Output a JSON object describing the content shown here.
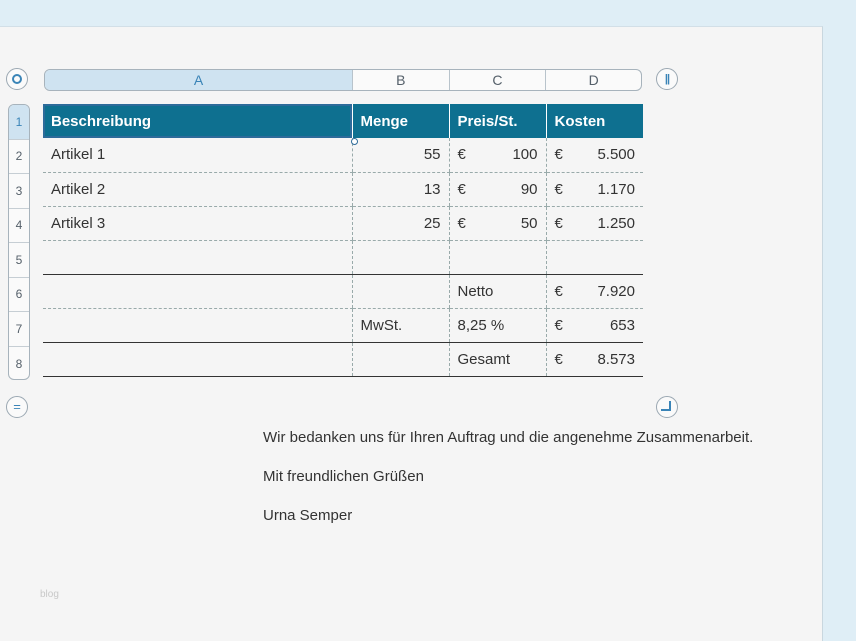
{
  "columns": [
    "A",
    "B",
    "C",
    "D"
  ],
  "rows": [
    "1",
    "2",
    "3",
    "4",
    "5",
    "6",
    "7",
    "8"
  ],
  "header": {
    "description": "Beschreibung",
    "quantity": "Menge",
    "unit_price": "Preis/St.",
    "cost": "Kosten"
  },
  "currency": "€",
  "items": [
    {
      "description": "Artikel 1",
      "quantity": "55",
      "unit_price": "100",
      "cost": "5.500"
    },
    {
      "description": "Artikel 2",
      "quantity": "13",
      "unit_price": "90",
      "cost": "1.170"
    },
    {
      "description": "Artikel 3",
      "quantity": "25",
      "unit_price": "50",
      "cost": "1.250"
    }
  ],
  "totals": {
    "net_label": "Netto",
    "net_value": "7.920",
    "vat_label": "MwSt.",
    "vat_rate": "8,25 %",
    "vat_value": "653",
    "gross_label": "Gesamt",
    "gross_value": "8.573"
  },
  "closing": {
    "thanks": "Wir bedanken uns für Ihren Auftrag und die angenehme Zusammenarbeit.",
    "regards": "Mit freundlichen Grüßen",
    "name": "Urna Semper"
  },
  "watermark": "blog",
  "colors": {
    "header_bg": "#0e7090",
    "selection": "#cfe3f1",
    "background": "#dfeef6"
  }
}
